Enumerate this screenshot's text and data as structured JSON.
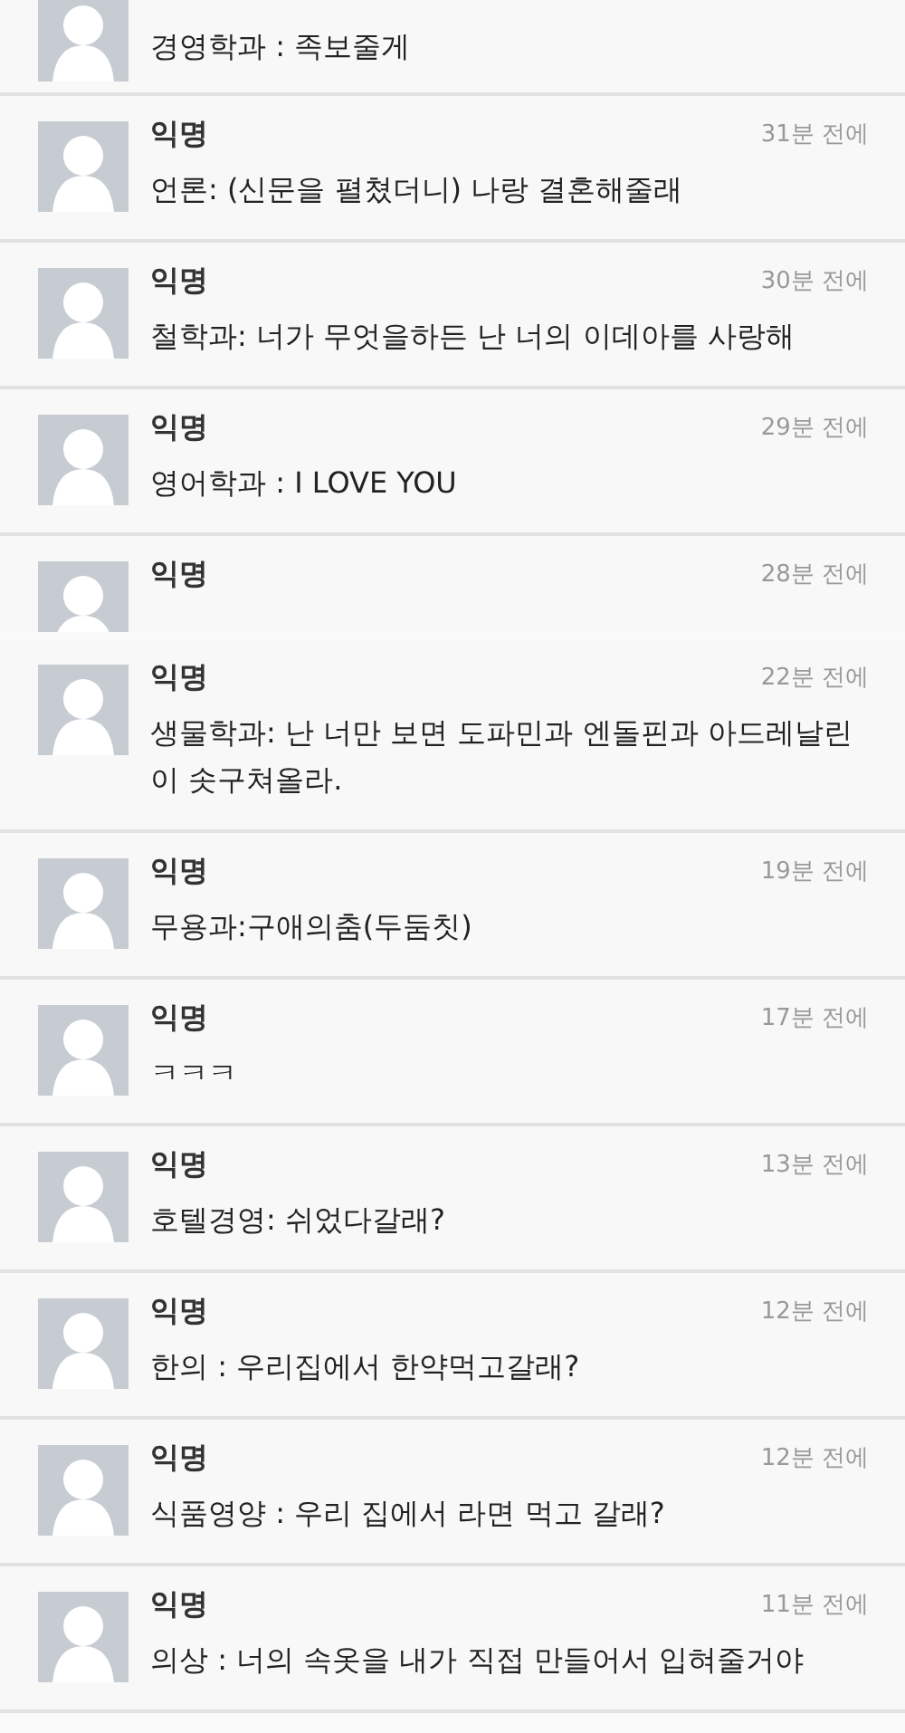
{
  "comments": [
    {
      "kind": "cut_top",
      "message": "경영학과 : 족보줄게"
    },
    {
      "kind": "full",
      "name": "익명",
      "time": "31분 전에",
      "message": "언론: (신문을 펼쳤더니) 나랑 결혼해줄래"
    },
    {
      "kind": "full",
      "name": "익명",
      "time": "30분 전에",
      "message": "철학과: 너가 무엇을하든 난 너의 이데아를 사랑해"
    },
    {
      "kind": "full",
      "name": "익명",
      "time": "29분 전에",
      "message": "영어학과 : I LOVE YOU"
    },
    {
      "kind": "cut_bottom",
      "name": "익명",
      "time": "28분 전에"
    },
    {
      "kind": "full",
      "name": "익명",
      "time": "22분 전에",
      "message": "생물학과: 난 너만 보면 도파민과 엔돌핀과 아드레날린이 솟구쳐올라."
    },
    {
      "kind": "full",
      "name": "익명",
      "time": "19분 전에",
      "message": "무용과:구애의춤(두둠칫)"
    },
    {
      "kind": "full",
      "name": "익명",
      "time": "17분 전에",
      "message": "ㅋㅋㅋ"
    },
    {
      "kind": "full",
      "name": "익명",
      "time": "13분 전에",
      "message": "호텔경영: 쉬었다갈래?"
    },
    {
      "kind": "full",
      "name": "익명",
      "time": "12분 전에",
      "message": "한의 : 우리집에서 한약먹고갈래?"
    },
    {
      "kind": "full",
      "name": "익명",
      "time": "12분 전에",
      "message": "식품영양 : 우리 집에서 라면 먹고 갈래?"
    },
    {
      "kind": "full",
      "name": "익명",
      "time": "11분 전에",
      "message": "의상 : 너의 속옷을 내가 직접 만들어서 입혀줄거야"
    }
  ]
}
